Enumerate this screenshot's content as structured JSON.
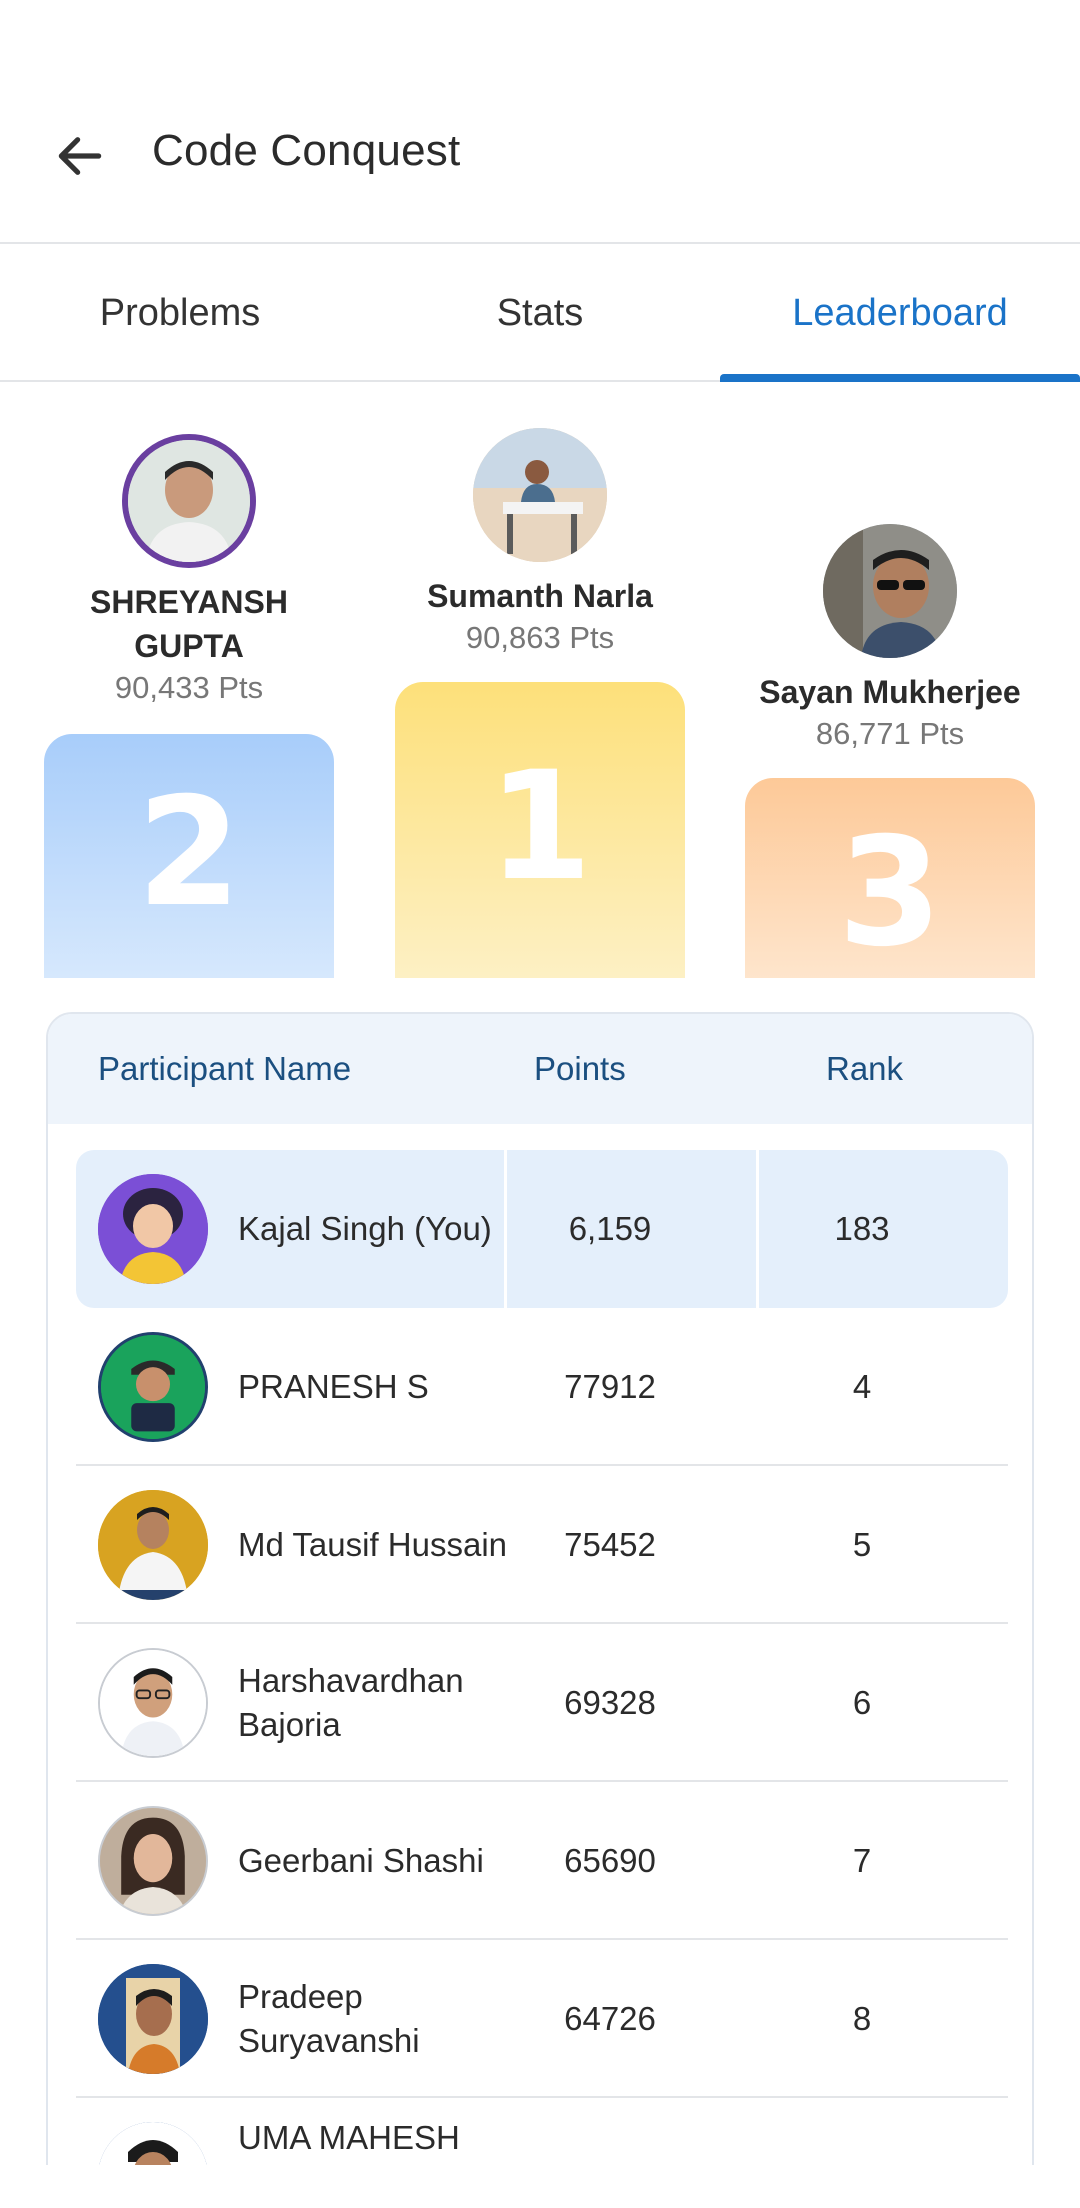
{
  "header": {
    "title": "Code Conquest",
    "back_icon": "arrow-left-icon"
  },
  "tabs": [
    {
      "label": "Problems",
      "active": false
    },
    {
      "label": "Stats",
      "active": false
    },
    {
      "label": "Leaderboard",
      "active": true
    }
  ],
  "podium": {
    "first": {
      "name": "Sumanth Narla",
      "points": "90,863 Pts",
      "place": "1",
      "color": "#fde9a0"
    },
    "second": {
      "name": "SHREYANSH GUPTA",
      "points": "90,433 Pts",
      "place": "2",
      "color": "#bcd9fb"
    },
    "third": {
      "name": "Sayan Mukherjee",
      "points": "86,771 Pts",
      "place": "3",
      "color": "#fdd9b4"
    }
  },
  "table": {
    "headers": {
      "name": "Participant Name",
      "points": "Points",
      "rank": "Rank"
    },
    "rows": [
      {
        "name": "Kajal Singh (You)",
        "points": "6,159",
        "rank": "183",
        "you": true
      },
      {
        "name": "PRANESH S",
        "points": "77912",
        "rank": "4"
      },
      {
        "name": "Md Tausif Hussain",
        "points": "75452",
        "rank": "5"
      },
      {
        "name": "Harshavardhan Bajoria",
        "points": "69328",
        "rank": "6"
      },
      {
        "name": "Geerbani Shashi",
        "points": "65690",
        "rank": "7"
      },
      {
        "name": "Pradeep Suryavanshi",
        "points": "64726",
        "rank": "8"
      },
      {
        "name": "UMA MAHESH",
        "points": "",
        "rank": ""
      }
    ]
  },
  "colors": {
    "accent": "#1a73c8",
    "table_header_bg": "#eef4fb",
    "you_row_bg": "#e4effb",
    "header_text": "#1b4f80"
  }
}
